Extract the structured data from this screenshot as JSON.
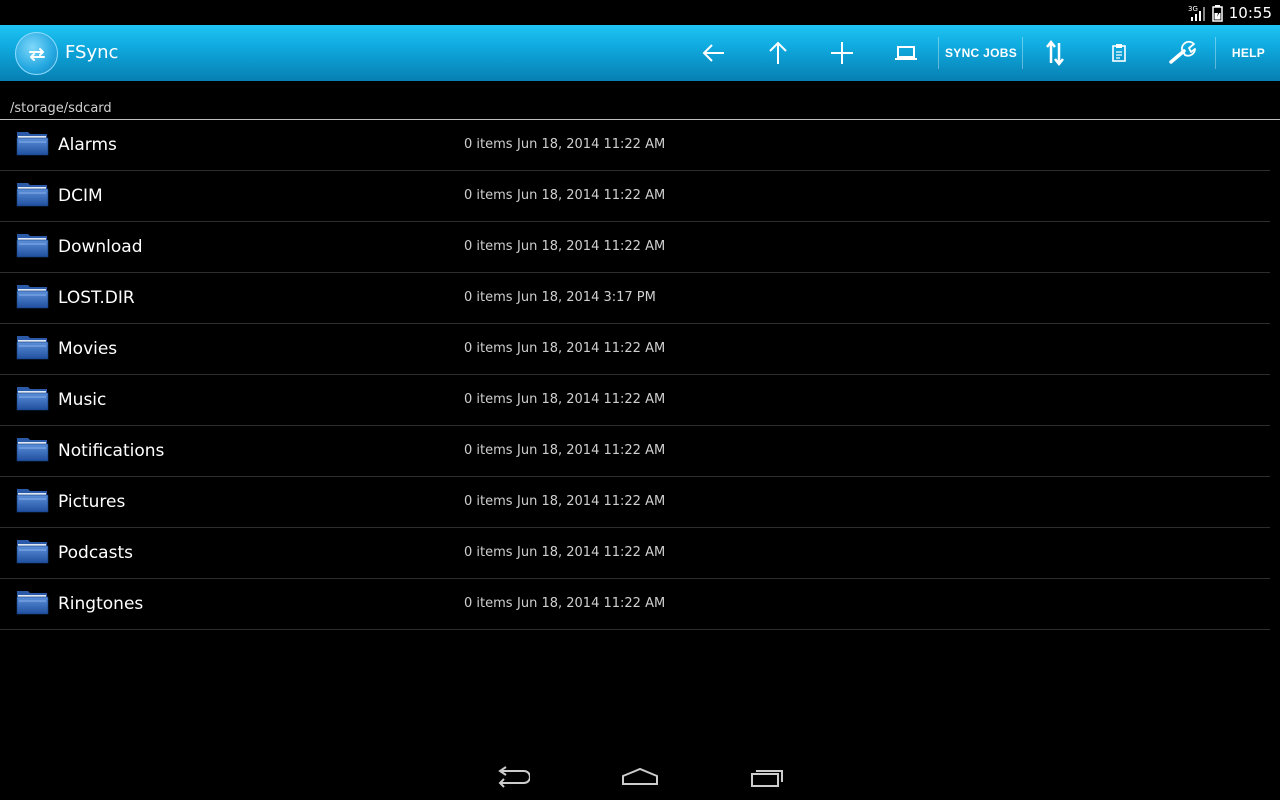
{
  "status_bar": {
    "network": "3G",
    "clock": "10:55"
  },
  "action_bar": {
    "title": "FSync",
    "app_icon": "sync-arrows-icon",
    "actions": [
      {
        "name": "back",
        "icon": "arrow-left-icon"
      },
      {
        "name": "up",
        "icon": "arrow-up-icon"
      },
      {
        "name": "new",
        "icon": "plus-icon"
      },
      {
        "name": "device",
        "icon": "laptop-icon"
      },
      {
        "name": "sync_jobs",
        "label": "SYNC JOBS"
      },
      {
        "name": "transfer",
        "icon": "transfer-arrows-icon"
      },
      {
        "name": "clipboard",
        "icon": "clipboard-icon"
      },
      {
        "name": "settings",
        "icon": "wrench-icon"
      },
      {
        "name": "help",
        "label": "HELP"
      }
    ]
  },
  "path": "/storage/sdcard",
  "files": [
    {
      "name": "Alarms",
      "count": "0 items",
      "date": "Jun 18, 2014 11:22 AM"
    },
    {
      "name": "DCIM",
      "count": "0 items",
      "date": "Jun 18, 2014 11:22 AM"
    },
    {
      "name": "Download",
      "count": "0 items",
      "date": "Jun 18, 2014 11:22 AM"
    },
    {
      "name": "LOST.DIR",
      "count": "0 items",
      "date": "Jun 18, 2014 3:17 PM"
    },
    {
      "name": "Movies",
      "count": "0 items",
      "date": "Jun 18, 2014 11:22 AM"
    },
    {
      "name": "Music",
      "count": "0 items",
      "date": "Jun 18, 2014 11:22 AM"
    },
    {
      "name": "Notifications",
      "count": "0 items",
      "date": "Jun 18, 2014 11:22 AM"
    },
    {
      "name": "Pictures",
      "count": "0 items",
      "date": "Jun 18, 2014 11:22 AM"
    },
    {
      "name": "Podcasts",
      "count": "0 items",
      "date": "Jun 18, 2014 11:22 AM"
    },
    {
      "name": "Ringtones",
      "count": "0 items",
      "date": "Jun 18, 2014 11:22 AM"
    }
  ],
  "nav_bar": {
    "buttons": [
      "back-icon",
      "home-icon",
      "recent-apps-icon"
    ]
  },
  "colors": {
    "action_bar_top": "#1fc4f4",
    "action_bar_bottom": "#077fb2",
    "background": "#000000",
    "folder_blue": "#2f66b8"
  }
}
